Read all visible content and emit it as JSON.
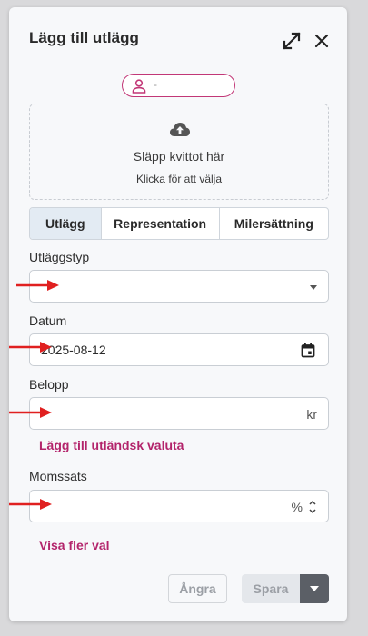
{
  "dialog": {
    "title": "Lägg till utlägg",
    "expand_icon": "expand-icon",
    "close_icon": "close-icon"
  },
  "user_chip": {
    "icon": "user-icon",
    "name": "-"
  },
  "upload": {
    "icon": "cloud-upload-icon",
    "title": "Släpp kvittot här",
    "subtitle": "Klicka för att välja"
  },
  "tabs": [
    {
      "label": "Utlägg",
      "active": true
    },
    {
      "label": "Representation",
      "active": false
    },
    {
      "label": "Milersättning",
      "active": false
    }
  ],
  "form": {
    "type": {
      "label": "Utläggstyp",
      "value": ""
    },
    "date": {
      "label": "Datum",
      "value": "2025-08-12"
    },
    "amount": {
      "label": "Belopp",
      "value": "",
      "suffix": "kr"
    },
    "foreign_currency_link": "Lägg till utländsk valuta",
    "vat": {
      "label": "Momssats",
      "value": "",
      "suffix": "%"
    },
    "more_options_link": "Visa fler val"
  },
  "actions": {
    "undo": "Ångra",
    "save": "Spara"
  },
  "colors": {
    "accent": "#b3246b",
    "annotation_arrow": "#e02020"
  }
}
